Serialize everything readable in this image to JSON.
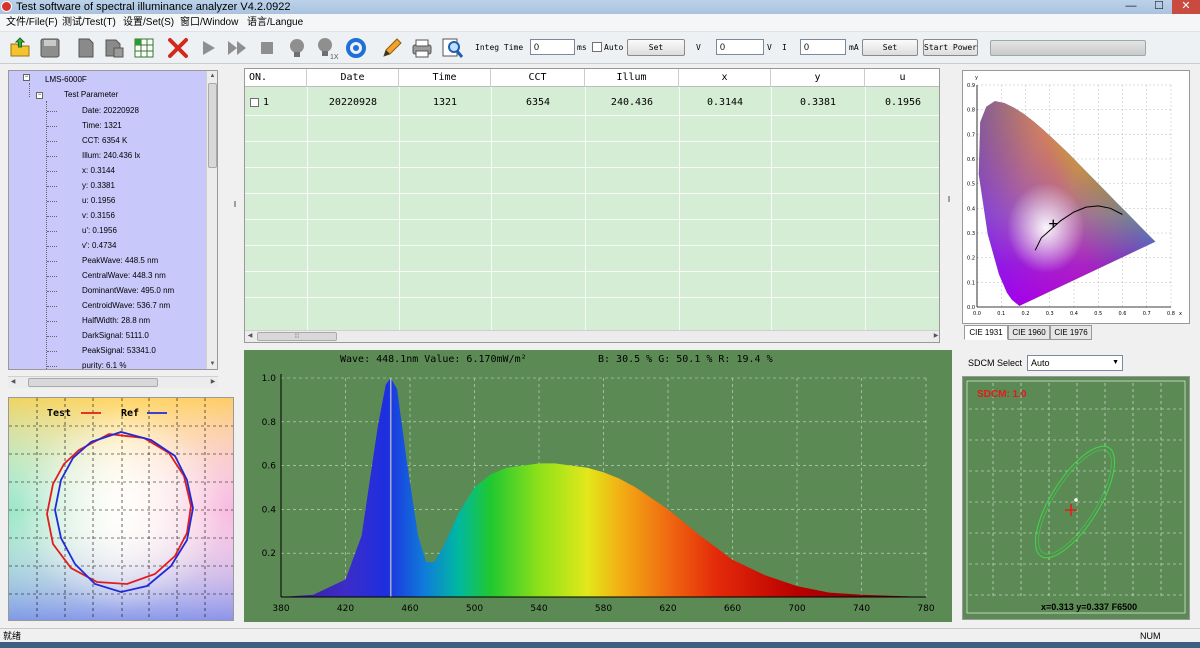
{
  "window": {
    "title": "Test software of spectral illuminance analyzer V4.2.0922",
    "min_glyph": "—",
    "max_glyph": "☐",
    "close_glyph": "✕"
  },
  "menu": [
    "文件/File(F)",
    "测试/Test(T)",
    "设置/Set(S)",
    "窗口/Window",
    "语言/Langue"
  ],
  "toolbar": {
    "icons": [
      "open-folder-icon",
      "save-icon",
      "copy-icon",
      "paste-icon",
      "excel-icon",
      "delete-icon",
      "play-icon",
      "fast-forward-icon",
      "stop-icon",
      "bulb-icon",
      "bulb-1x-icon",
      "refresh-icon",
      "pencil-icon",
      "printer-icon",
      "magnifier-icon"
    ],
    "bulb_badge": "1X",
    "integ_label": "Integ Time",
    "integ_value": "0",
    "integ_unit": "ms",
    "auto_label": "Auto",
    "set1_label": "Set",
    "v_label": "V",
    "v_value": "0",
    "v_unit": "V",
    "i_label": "I",
    "i_value": "0",
    "i_unit": "mA",
    "set2_label": "Set",
    "start_power_label": "Start Power"
  },
  "tree": {
    "root": "LMS-6000F",
    "group": "Test Parameter",
    "items": [
      "Date: 20220928",
      "Time: 1321",
      "CCT: 6354 K",
      "Illum: 240.436 lx",
      "x: 0.3144",
      "y: 0.3381",
      "u: 0.1956",
      "v: 0.3156",
      "u': 0.1956",
      "v': 0.4734",
      "PeakWave: 448.5 nm",
      "CentralWave: 448.3 nm",
      "DominantWave: 495.0 nm",
      "CentroidWave: 536.7 nm",
      "HalfWidth: 28.8 nm",
      "DarkSignal: 5111.0",
      "PeakSignal: 53341.0",
      "purity: 6.1 %"
    ]
  },
  "radar": {
    "legend_test": "Test",
    "legend_ref": "Ref",
    "test_color": "#e01c1c",
    "ref_color": "#1f2bd9"
  },
  "table": {
    "columns": [
      "ON.",
      "Date",
      "Time",
      "CCT",
      "Illum",
      "x",
      "y",
      "u"
    ],
    "rows": [
      [
        "1",
        "20220928",
        "1321",
        "6354",
        "240.436",
        "0.3144",
        "0.3381",
        "0.1956"
      ]
    ],
    "scroll_grip": "⁞⁞⁞"
  },
  "spectrum": {
    "info_wave": "Wave: 448.1nm Value: 6.170mW/m²",
    "info_rgb": "B: 30.5 %  G: 50.1 %  R: 19.4 %",
    "background": "#5c8a55"
  },
  "chart_data": {
    "type": "area",
    "title": "",
    "xlabel": "",
    "ylabel": "",
    "xlim": [
      380,
      780
    ],
    "ylim": [
      0,
      1.0
    ],
    "xticks": [
      380,
      420,
      460,
      500,
      540,
      580,
      620,
      660,
      700,
      740,
      780
    ],
    "yticks": [
      "1.0",
      "0.8",
      "0.6",
      "0.4",
      "0.2"
    ],
    "cursor_wave": 448.1,
    "x": [
      380,
      400,
      420,
      430,
      440,
      445,
      448,
      452,
      458,
      465,
      470,
      475,
      480,
      490,
      500,
      510,
      520,
      530,
      540,
      550,
      560,
      570,
      580,
      590,
      600,
      620,
      640,
      660,
      680,
      700,
      720,
      740,
      760,
      780
    ],
    "values": [
      0.0,
      0.01,
      0.08,
      0.28,
      0.78,
      0.97,
      1.0,
      0.95,
      0.62,
      0.28,
      0.16,
      0.16,
      0.22,
      0.38,
      0.5,
      0.56,
      0.59,
      0.6,
      0.61,
      0.61,
      0.6,
      0.59,
      0.57,
      0.54,
      0.5,
      0.4,
      0.28,
      0.17,
      0.1,
      0.05,
      0.02,
      0.01,
      0.005,
      0.0
    ]
  },
  "cie": {
    "tabs": [
      "CIE 1931",
      "CIE 1960",
      "CIE 1976"
    ],
    "active_tab": "CIE 1931",
    "axis_label_y": "y",
    "axis_label_x": "x",
    "x_ticks": [
      "0.0",
      "0.1",
      "0.2",
      "0.3",
      "0.4",
      "0.5",
      "0.6",
      "0.7",
      "0.8"
    ],
    "y_ticks": [
      "0.9",
      "0.8",
      "0.7",
      "0.6",
      "0.5",
      "0.4",
      "0.3",
      "0.2",
      "0.1",
      "0.0"
    ],
    "point": {
      "x": 0.3144,
      "y": 0.3381
    }
  },
  "sdcm": {
    "select_label": "SDCM Select",
    "select_value": "Auto",
    "title": "SDCM: 1.0",
    "coords": "x=0.313 y=0.337 F6500",
    "ellipse_color": "#3ed84a",
    "marker_color": "#e01c1c"
  },
  "status": {
    "left": "就绪",
    "right": "NUM"
  }
}
